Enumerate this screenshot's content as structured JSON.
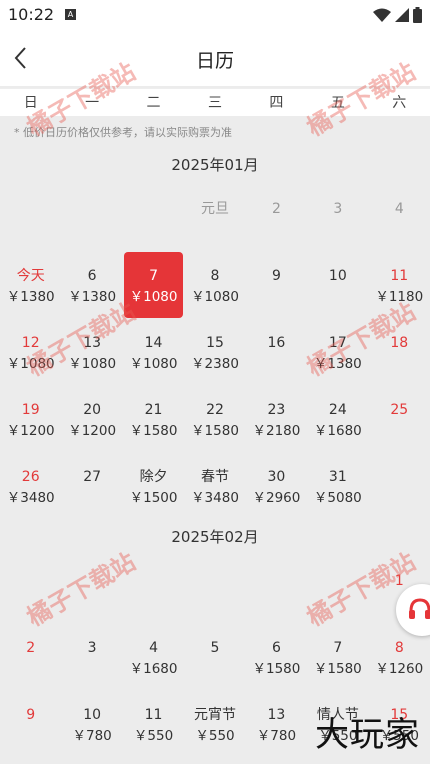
{
  "status": {
    "time": "10:22",
    "notification_icon": "A"
  },
  "header": {
    "title": "日历"
  },
  "weekdays": [
    "日",
    "一",
    "二",
    "三",
    "四",
    "五",
    "六"
  ],
  "hint": "* 低价日历价格仅供参考，请以实际购票为准",
  "months": [
    {
      "title": "2025年01月",
      "rows": [
        [
          null,
          null,
          null,
          {
            "d": "元旦",
            "p": "",
            "s": "dim"
          },
          {
            "d": "2",
            "p": "",
            "s": "dim"
          },
          {
            "d": "3",
            "p": "",
            "s": "dim"
          },
          {
            "d": "4",
            "p": "",
            "s": "dim"
          }
        ],
        [
          {
            "d": "今天",
            "p": "￥1380",
            "s": "red"
          },
          {
            "d": "6",
            "p": "￥1380",
            "s": ""
          },
          {
            "d": "7",
            "p": "￥1080",
            "s": "sel"
          },
          {
            "d": "8",
            "p": "￥1080",
            "s": ""
          },
          {
            "d": "9",
            "p": "",
            "s": ""
          },
          {
            "d": "10",
            "p": "",
            "s": ""
          },
          {
            "d": "11",
            "p": "￥1180",
            "s": "red"
          }
        ],
        [
          {
            "d": "12",
            "p": "￥1080",
            "s": "red"
          },
          {
            "d": "13",
            "p": "￥1080",
            "s": ""
          },
          {
            "d": "14",
            "p": "￥1080",
            "s": ""
          },
          {
            "d": "15",
            "p": "￥2380",
            "s": ""
          },
          {
            "d": "16",
            "p": "",
            "s": ""
          },
          {
            "d": "17",
            "p": "￥1380",
            "s": ""
          },
          {
            "d": "18",
            "p": "",
            "s": "red"
          }
        ],
        [
          {
            "d": "19",
            "p": "￥1200",
            "s": "red"
          },
          {
            "d": "20",
            "p": "￥1200",
            "s": ""
          },
          {
            "d": "21",
            "p": "￥1580",
            "s": ""
          },
          {
            "d": "22",
            "p": "￥1580",
            "s": ""
          },
          {
            "d": "23",
            "p": "￥2180",
            "s": ""
          },
          {
            "d": "24",
            "p": "￥1680",
            "s": ""
          },
          {
            "d": "25",
            "p": "",
            "s": "red"
          }
        ],
        [
          {
            "d": "26",
            "p": "￥3480",
            "s": "red"
          },
          {
            "d": "27",
            "p": "",
            "s": ""
          },
          {
            "d": "除夕",
            "p": "￥1500",
            "s": ""
          },
          {
            "d": "春节",
            "p": "￥3480",
            "s": ""
          },
          {
            "d": "30",
            "p": "￥2960",
            "s": ""
          },
          {
            "d": "31",
            "p": "￥5080",
            "s": ""
          },
          null
        ]
      ]
    },
    {
      "title": "2025年02月",
      "rows": [
        [
          null,
          null,
          null,
          null,
          null,
          null,
          {
            "d": "1",
            "p": "",
            "s": "red"
          }
        ],
        [
          {
            "d": "2",
            "p": "",
            "s": "red"
          },
          {
            "d": "3",
            "p": "",
            "s": ""
          },
          {
            "d": "4",
            "p": "￥1680",
            "s": ""
          },
          {
            "d": "5",
            "p": "",
            "s": ""
          },
          {
            "d": "6",
            "p": "￥1580",
            "s": ""
          },
          {
            "d": "7",
            "p": "￥1580",
            "s": ""
          },
          {
            "d": "8",
            "p": "￥1260",
            "s": "red"
          }
        ],
        [
          {
            "d": "9",
            "p": "",
            "s": "red"
          },
          {
            "d": "10",
            "p": "￥780",
            "s": ""
          },
          {
            "d": "11",
            "p": "￥550",
            "s": ""
          },
          {
            "d": "元宵节",
            "p": "￥550",
            "s": ""
          },
          {
            "d": "13",
            "p": "￥780",
            "s": ""
          },
          {
            "d": "情人节",
            "p": "￥550",
            "s": ""
          },
          {
            "d": "15",
            "p": "￥550",
            "s": "red"
          }
        ]
      ]
    }
  ],
  "watermark": "橘子下载站",
  "bottom_logo": "大玩家",
  "colors": {
    "accent": "#e53538",
    "weekend": "#e23a3a"
  }
}
